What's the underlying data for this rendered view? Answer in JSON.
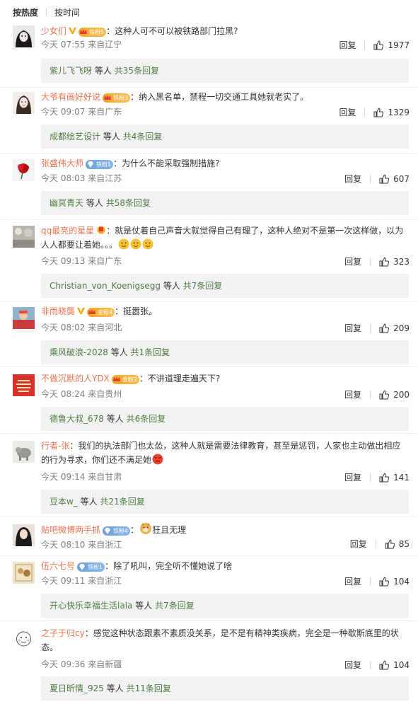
{
  "sort": {
    "hot": "按热度",
    "time": "按时间"
  },
  "comments": [
    {
      "user": "少女们",
      "verified": true,
      "fan_badge": "铁粉5",
      "fan_style": "gold",
      "text": "：这种人可不可以被铁路部门拉黑?",
      "time": "今天 07:55",
      "location": "来自辽宁",
      "reply_label": "回复",
      "likes": "1977",
      "reply_user": "紫儿飞飞呀",
      "reply_mid": "等人",
      "reply_total": "共35条回复"
    },
    {
      "user": "大爷有画好好说",
      "verified": false,
      "fan_badge": "铁粉3",
      "fan_style": "gold",
      "text": "：纳入黑名单，禁程一切交通工具她就老实了。",
      "time": "今天 09:07",
      "location": "来自广东",
      "reply_label": "回复",
      "likes": "1329",
      "reply_user": "成都绘艺设计",
      "reply_mid": "等人",
      "reply_total": "共4条回复"
    },
    {
      "user": "张盛伟大师",
      "verified": false,
      "fan_badge": "铁粉1",
      "fan_style": "iron",
      "text": "：为什么不能采取强制措施?",
      "time": "今天 08:03",
      "location": "来自江苏",
      "reply_label": "回复",
      "likes": "607",
      "reply_user": "幽冥青天",
      "reply_mid": "等人",
      "reply_total": "共58条回复"
    },
    {
      "user": "qq最亮的星星",
      "verified": false,
      "fan_badge": "",
      "fan_style": "red",
      "text": "：就是仗着自己声音大就觉得自己有理了，这种人绝对不是第一次这样做，以为人人都要让着她。。。",
      "time": "今天 09:13",
      "location": "来自广东",
      "reply_label": "回复",
      "likes": "323",
      "reply_user": "Christian_von_Koenigsegg",
      "reply_mid": "等人",
      "reply_total": "共7条回复"
    },
    {
      "user": "非雨晓龑",
      "verified": true,
      "fan_badge": "金粉4",
      "fan_style": "gold",
      "text": "：挺嚣张。",
      "time": "今天 08:02",
      "location": "来自河北",
      "reply_label": "回复",
      "likes": "209",
      "reply_user": "乘风破浪-2028",
      "reply_mid": "等人",
      "reply_total": "共1条回复"
    },
    {
      "user": "不做沉默的人YDX",
      "verified": false,
      "fan_badge": "金粉2",
      "fan_style": "gold",
      "text": "：不讲道理走遍天下?",
      "time": "今天 08:24",
      "location": "来自贵州",
      "reply_label": "回复",
      "likes": "200",
      "reply_user": "德鲁大叔_678",
      "reply_mid": "等人",
      "reply_total": "共6条回复"
    },
    {
      "user": "行者-张",
      "verified": false,
      "fan_badge": "",
      "fan_style": "",
      "text": "：我们的执法部门也太怂，这种人就是需要法律教育，甚至是惩罚，人家也主动做出相应的行为寻求，你们还不满足她",
      "time": "今天 09:14",
      "location": "来自甘肃",
      "reply_label": "回复",
      "likes": "141",
      "reply_user": "豆本w_",
      "reply_mid": "等人",
      "reply_total": "共21条回复"
    },
    {
      "user": "贴吧微博两手抓",
      "verified": false,
      "fan_badge": "铁粉4",
      "fan_style": "iron",
      "text": "狂且无理",
      "time": "今天 08:10",
      "location": "来自浙江",
      "reply_label": "回复",
      "likes": "85",
      "reply_user": "",
      "reply_mid": "",
      "reply_total": ""
    },
    {
      "user": "伍六七号",
      "verified": false,
      "fan_badge": "铁粉1",
      "fan_style": "iron",
      "text": "：除了吼叫，完全听不懂她说了啥",
      "time": "今天 09:11",
      "location": "来自浙江",
      "reply_label": "回复",
      "likes": "104",
      "reply_user": "开心快乐幸福生活lala",
      "reply_mid": "等人",
      "reply_total": "共7条回复"
    },
    {
      "user": "之子于归cy",
      "verified": false,
      "fan_badge": "",
      "fan_style": "",
      "text": "：感觉这种状态跟素不素质没关系，是不是有精神类疾病，完全是一种歇斯底里的状态。",
      "time": "今天 09:36",
      "location": "来自新疆",
      "reply_label": "回复",
      "likes": "104",
      "reply_user": "夏日昕情_925",
      "reply_mid": "等人",
      "reply_total": "共11条回复"
    }
  ]
}
